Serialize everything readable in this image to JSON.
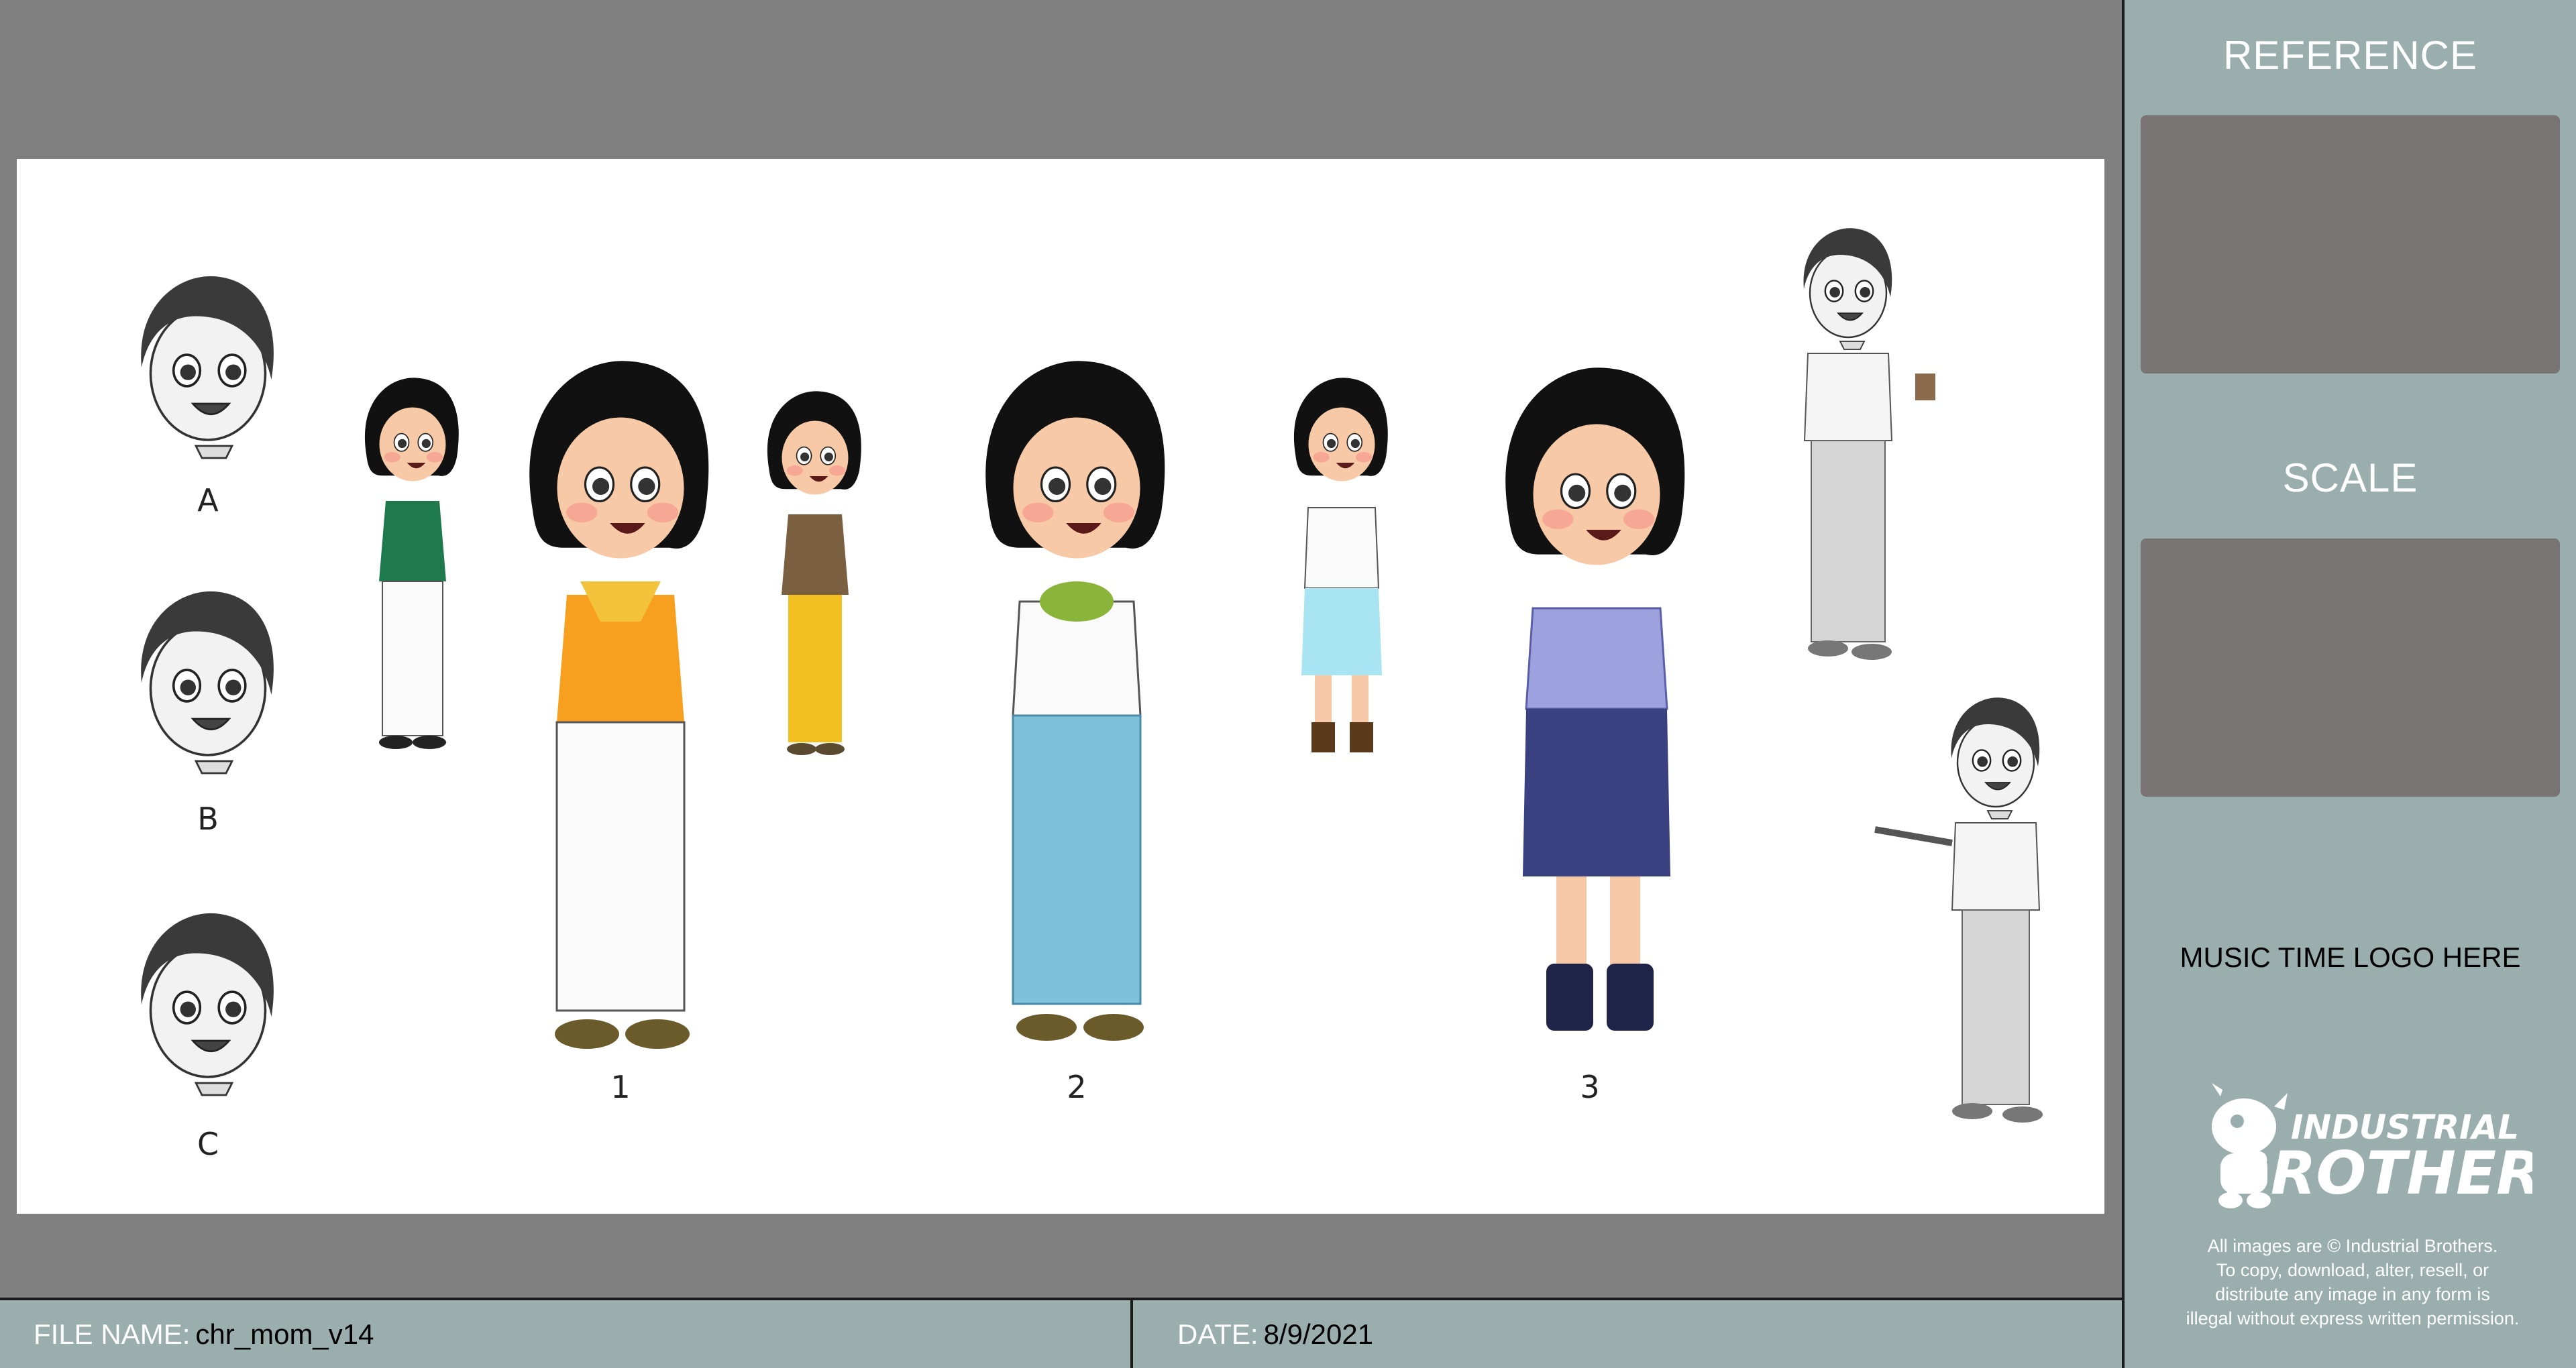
{
  "sidebar": {
    "reference_title": "REFERENCE",
    "scale_title": "SCALE",
    "logo_placeholder": "MUSIC TIME LOGO HERE",
    "brand_line1": "INDUSTRIAL",
    "brand_line2": "BROTHERS",
    "copyright": [
      "All images are © Industrial Brothers.",
      "To copy, download, alter, resell, or",
      "distribute any image in any form is",
      "illegal without express written permission."
    ]
  },
  "footer": {
    "file_label": "FILE NAME:",
    "file_value": "chr_mom_v14",
    "date_label": "DATE:",
    "date_value": "8/9/2021"
  },
  "sheet": {
    "head_labels": [
      "A",
      "B",
      "C"
    ],
    "outfit_labels": [
      "1",
      "2",
      "3"
    ]
  },
  "colors": {
    "workspace": "#808080",
    "sidebar": "#9aaeae",
    "placeholder_box": "#797474",
    "outfit1_top": "#f7a020",
    "outfit2_pants": "#7fc0da",
    "outfit3_top": "#9da2de",
    "outfit3_skirt": "#3a4181"
  }
}
